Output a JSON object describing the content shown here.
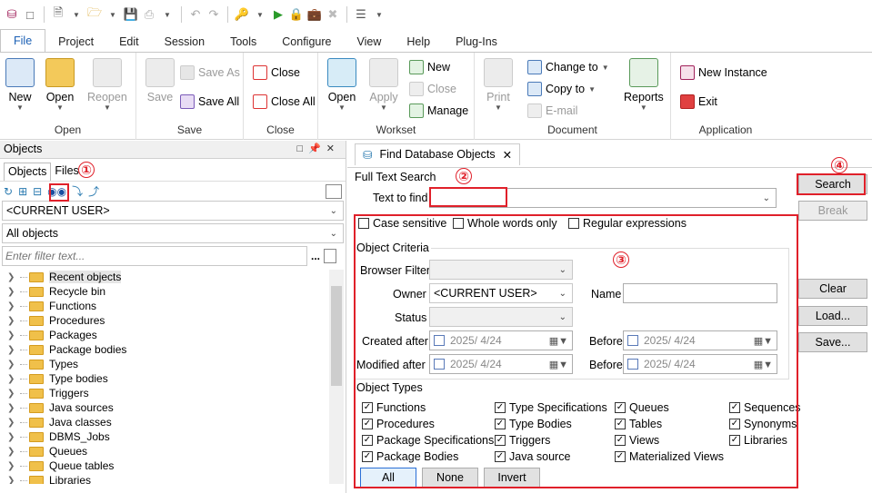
{
  "qat": {
    "icons": [
      "db-icon",
      "square-icon",
      "new-file-icon",
      "open-folder-icon",
      "save-icon",
      "print-icon",
      "undo-icon",
      "redo-icon",
      "key-icon",
      "run-icon",
      "lock-icon",
      "bag-icon",
      "tools-icon",
      "settings-icon"
    ]
  },
  "menu": [
    "File",
    "Project",
    "Edit",
    "Session",
    "Tools",
    "Configure",
    "View",
    "Help",
    "Plug-Ins"
  ],
  "ribbon": {
    "open_group": {
      "label": "Open",
      "new": "New",
      "open": "Open",
      "reopen": "Reopen"
    },
    "save_group": {
      "label": "Save",
      "save": "Save",
      "save_as": "Save As",
      "save_all": "Save All"
    },
    "close_group": {
      "label": "Close",
      "close": "Close",
      "close_all": "Close All"
    },
    "workset_group": {
      "label": "Workset",
      "open": "Open",
      "apply": "Apply",
      "new": "New",
      "close": "Close",
      "manage": "Manage"
    },
    "document_group": {
      "label": "Document",
      "print": "Print",
      "change_to": "Change to",
      "copy_to": "Copy to",
      "email": "E-mail",
      "reports": "Reports"
    },
    "application_group": {
      "label": "Application",
      "new_instance": "New Instance",
      "exit": "Exit"
    }
  },
  "objects_panel": {
    "title": "Objects",
    "tabs": [
      "Objects",
      "Files"
    ],
    "user_combo": "<CURRENT USER>",
    "filter_combo": "All objects",
    "filter_placeholder": "Enter filter text...",
    "filter_dots": "...",
    "tree": [
      "Recent objects",
      "Recycle bin",
      "Functions",
      "Procedures",
      "Packages",
      "Package bodies",
      "Types",
      "Type bodies",
      "Triggers",
      "Java sources",
      "Java classes",
      "DBMS_Jobs",
      "Queues",
      "Queue tables",
      "Libraries"
    ]
  },
  "find": {
    "tab_title": "Find Database Objects",
    "tab_close": "✕",
    "full_text_search": "Full Text Search",
    "text_to_find_label": "Text to find",
    "text_value": "",
    "case_sensitive": "Case sensitive",
    "whole_words": "Whole words only",
    "regex": "Regular expressions",
    "object_criteria": "Object Criteria",
    "browser_filter": "Browser Filter",
    "owner": "Owner",
    "owner_value": "<CURRENT USER>",
    "name": "Name",
    "status": "Status",
    "created_after": "Created after",
    "modified_after": "Modified after",
    "before": "Before",
    "date_value": "2025/  4/24",
    "object_types": "Object Types",
    "types": [
      {
        "label": "Functions",
        "checked": true
      },
      {
        "label": "Type Specifications",
        "checked": true
      },
      {
        "label": "Queues",
        "checked": true
      },
      {
        "label": "Sequences",
        "checked": true
      },
      {
        "label": "Procedures",
        "checked": true
      },
      {
        "label": "Type Bodies",
        "checked": true
      },
      {
        "label": "Tables",
        "checked": true
      },
      {
        "label": "Synonyms",
        "checked": true
      },
      {
        "label": "Package Specifications",
        "checked": true
      },
      {
        "label": "Triggers",
        "checked": true
      },
      {
        "label": "Views",
        "checked": true
      },
      {
        "label": "Libraries",
        "checked": true
      },
      {
        "label": "Package Bodies",
        "checked": true
      },
      {
        "label": "Java source",
        "checked": true
      },
      {
        "label": "Materialized Views",
        "checked": true
      }
    ],
    "all": "All",
    "none": "None",
    "invert": "Invert",
    "search": "Search",
    "break": "Break",
    "clear": "Clear",
    "load": "Load...",
    "save": "Save..."
  },
  "annotations": {
    "m1": "①",
    "m2": "②",
    "m3": "③",
    "m4": "④",
    "color": "#e0202a"
  }
}
